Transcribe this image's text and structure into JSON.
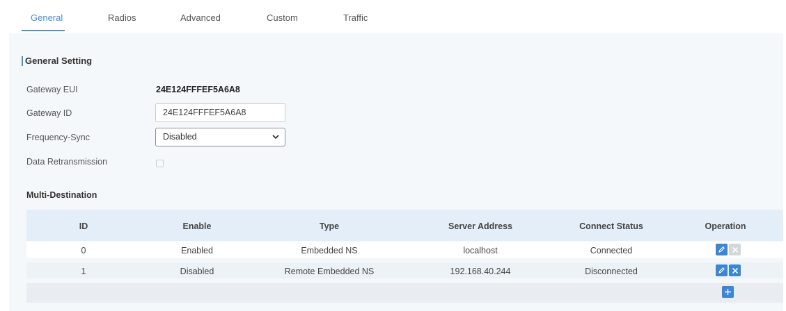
{
  "tabs": [
    {
      "label": "General",
      "active": true
    },
    {
      "label": "Radios",
      "active": false
    },
    {
      "label": "Advanced",
      "active": false
    },
    {
      "label": "Custom",
      "active": false
    },
    {
      "label": "Traffic",
      "active": false
    }
  ],
  "section": {
    "title": "General Setting"
  },
  "fields": {
    "gateway_eui": {
      "label": "Gateway EUI",
      "value": "24E124FFFEF5A6A8"
    },
    "gateway_id": {
      "label": "Gateway ID",
      "value": "24E124FFFEF5A6A8"
    },
    "frequency_sync": {
      "label": "Frequency-Sync",
      "value": "Disabled"
    },
    "data_retransmission": {
      "label": "Data Retransmission",
      "checked": false
    }
  },
  "multi_destination": {
    "title": "Multi-Destination",
    "columns": [
      "ID",
      "Enable",
      "Type",
      "Server Address",
      "Connect Status",
      "Operation"
    ],
    "rows": [
      {
        "id": "0",
        "enable": "Enabled",
        "type": "Embedded NS",
        "server_address": "localhost",
        "connect_status": "Connected",
        "delete_enabled": false
      },
      {
        "id": "1",
        "enable": "Disabled",
        "type": "Remote Embedded NS",
        "server_address": "192.168.40.244",
        "connect_status": "Disconnected",
        "delete_enabled": true
      }
    ]
  },
  "icons": {
    "edit": "pencil-icon",
    "delete": "close-icon",
    "add": "plus-icon",
    "select_arrow": "chevron-down-icon"
  },
  "colors": {
    "accent": "#4a8fd1",
    "button_blue": "#3b86d6",
    "button_disabled": "#d3d7dc",
    "table_header": "#e4eef8"
  }
}
